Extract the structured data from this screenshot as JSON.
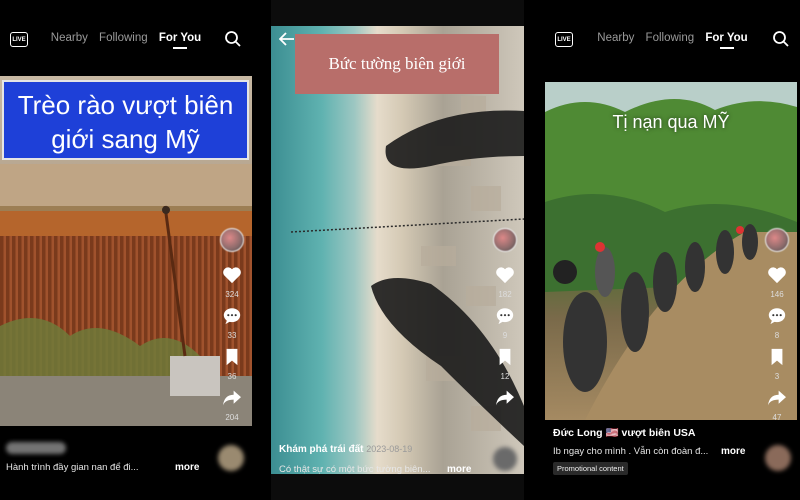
{
  "panels": [
    {
      "tabs": [
        "Nearby",
        "Following",
        "For You"
      ],
      "live_label": "LIVE",
      "overlay_title": "Trèo rào vượt biên giới sang Mỹ",
      "likes": "324",
      "comments": "33",
      "saves": "36",
      "shares": "204",
      "caption": "Hành trình đầy gian nan để đi...",
      "more": "more"
    },
    {
      "overlay_title": "Bức tường biên giới",
      "likes": "182",
      "comments": "9",
      "saves": "12",
      "author": "Khám phá trái đất",
      "date": "2023-08-19",
      "caption": "Có thật sự có một bức tường biên...",
      "more": "more"
    },
    {
      "tabs": [
        "Nearby",
        "Following",
        "For You"
      ],
      "live_label": "LIVE",
      "overlay_title": "Tị nạn qua MỸ",
      "likes": "146",
      "comments": "8",
      "saves": "3",
      "shares": "47",
      "author": "Đức Long 🇺🇸 vượt biên USA",
      "caption": "Ib ngay cho mình . Vẫn còn đoàn đ...",
      "more": "more",
      "badge": "Promotional content"
    }
  ],
  "colors": {
    "title_bg": "#1e40d8",
    "title2_bg": "#b86e6a",
    "heart": "#ffffff"
  },
  "icons": [
    "live-icon",
    "search-icon",
    "heart-icon",
    "comment-icon",
    "bookmark-icon",
    "share-icon",
    "back-arrow-icon"
  ]
}
